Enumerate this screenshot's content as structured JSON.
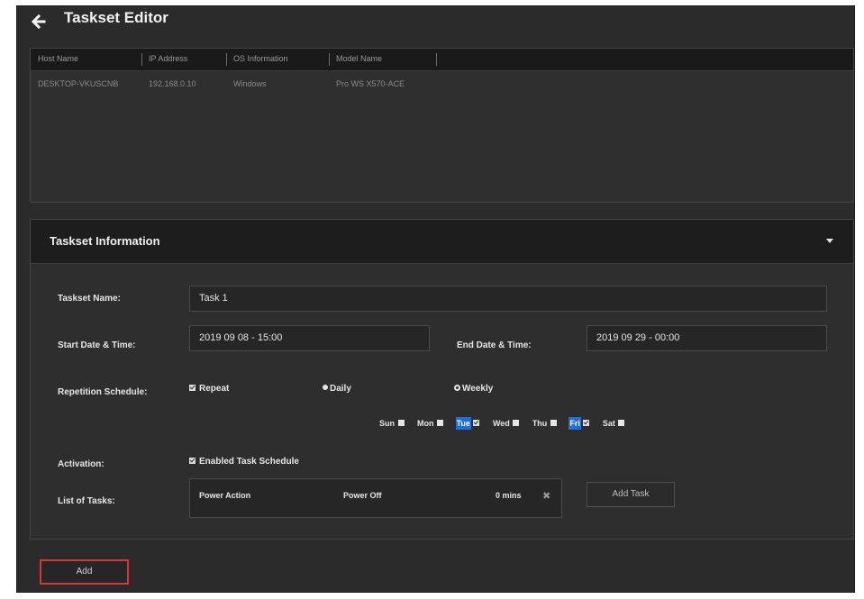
{
  "header": {
    "title": "Taskset Editor"
  },
  "host_table": {
    "columns": [
      "Host Name",
      "IP Address",
      "OS Information",
      "Model Name"
    ],
    "rows": [
      [
        "DESKTOP-VKUSCNB",
        "192.168.0.10",
        "Windows",
        "Pro WS X570-ACE"
      ]
    ]
  },
  "taskset": {
    "section_title": "Taskset Information",
    "name_label": "Taskset Name:",
    "name_value": "Task 1",
    "start_label": "Start Date & Time:",
    "start_value": "2019 09 08 - 15:00",
    "end_label": "End Date & Time:",
    "end_value": "2019 09 29 - 00:00",
    "repetition_label": "Repetition Schedule:",
    "repeat_label": "Repeat",
    "daily_label": "Daily",
    "weekly_label": "Weekly",
    "days": [
      {
        "label": "Sun",
        "checked": false,
        "selected": false
      },
      {
        "label": "Mon",
        "checked": false,
        "selected": false
      },
      {
        "label": "Tue",
        "checked": true,
        "selected": true
      },
      {
        "label": "Wed",
        "checked": false,
        "selected": false
      },
      {
        "label": "Thu",
        "checked": false,
        "selected": false
      },
      {
        "label": "Fri",
        "checked": true,
        "selected": true
      },
      {
        "label": "Sat",
        "checked": false,
        "selected": false
      }
    ],
    "activation_label": "Activation:",
    "enabled_label": "Enabled Task Schedule",
    "tasks_label": "List of Tasks:",
    "tasks": [
      {
        "action": "Power Action",
        "type": "Power Off",
        "duration": "0 mins"
      }
    ],
    "add_task_label": "Add Task"
  },
  "footer": {
    "add_label": "Add"
  },
  "colors": {
    "accent": "#1e6fd9",
    "highlight_border": "#d9343a",
    "background": "#2b2b2b"
  },
  "icons": {
    "back": "arrow-left-icon",
    "collapse": "caret-down-icon",
    "remove": "close-icon"
  }
}
